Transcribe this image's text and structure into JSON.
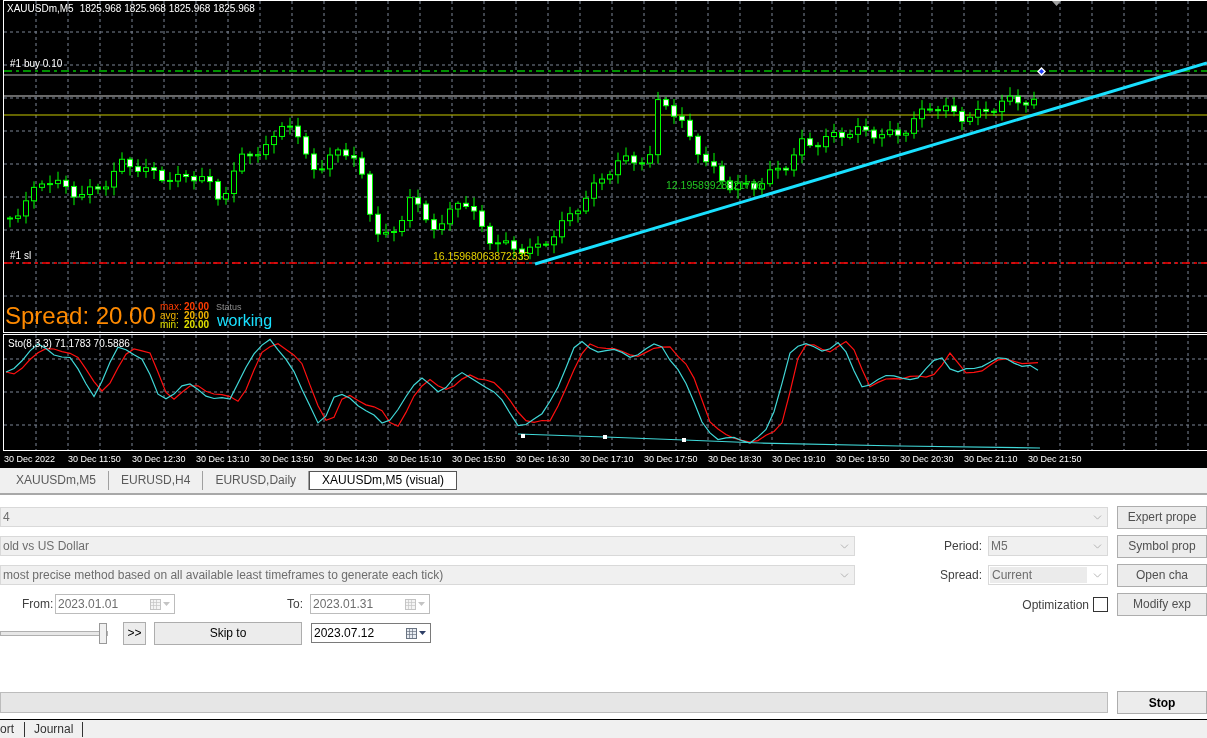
{
  "chart": {
    "symbol": "XAUUSDm,M5",
    "prices": "1825.968 1825.968 1825.968 1825.968",
    "order_lines": [
      {
        "kind": "buy",
        "label": "#1 buy 0.10"
      },
      {
        "kind": "stop_loss",
        "label": "#1 sl"
      }
    ],
    "price_labels": [
      {
        "text": "12.19589928821776",
        "color": "#22c322"
      },
      {
        "text": "16.15968063872335",
        "color": "#e6d200"
      }
    ],
    "spread": {
      "label": "Spread: 20.00",
      "stats": [
        {
          "name": "max:",
          "value": "20.00",
          "color": "#ff3c00"
        },
        {
          "name": "avg:",
          "value": "20.00",
          "color": "#f0b400"
        },
        {
          "name": "min:",
          "value": "20.00",
          "color": "#e0e000"
        }
      ]
    },
    "status": {
      "label": "Status",
      "value": "working"
    },
    "indicator": {
      "label": "Sto(8,3,3) 71.1783 70.5886"
    },
    "time_labels": [
      "30 Dec 2022",
      "30 Dec 11:50",
      "30 Dec 12:30",
      "30 Dec 13:10",
      "30 Dec 13:50",
      "30 Dec 14:30",
      "30 Dec 15:10",
      "30 Dec 15:50",
      "30 Dec 16:30",
      "30 Dec 17:10",
      "30 Dec 17:50",
      "30 Dec 18:30",
      "30 Dec 19:10",
      "30 Dec 19:50",
      "30 Dec 20:30",
      "30 Dec 21:10",
      "30 Dec 21:50"
    ]
  },
  "chart_tabs": [
    {
      "label": "XAUUSDm,M5",
      "selected": false
    },
    {
      "label": "EURUSD,H4",
      "selected": false
    },
    {
      "label": "EURUSD,Daily",
      "selected": false
    },
    {
      "label": "XAUUSDm,M5 (visual)",
      "selected": true
    }
  ],
  "tester": {
    "expert": {
      "value": "4",
      "disabled": true
    },
    "symbol": {
      "value": "old vs US Dollar",
      "disabled": true
    },
    "model": {
      "value": "most precise method based on all available least timeframes to generate each tick)",
      "disabled": true
    },
    "period": {
      "label": "Period:",
      "value": "M5",
      "disabled": true
    },
    "spread": {
      "label": "Spread:",
      "value": "Current",
      "disabled": true
    },
    "date_from": {
      "label": "From:",
      "value": "2023.01.01",
      "disabled": true
    },
    "date_to": {
      "label": "To:",
      "value": "2023.01.31",
      "disabled": true
    },
    "optimization": {
      "label": "Optimization",
      "checked": false
    },
    "speed_slider": {
      "level": 1
    },
    "fast_forward_button": {
      "label": ">>"
    },
    "skip_to_button": {
      "label": "Skip to"
    },
    "skip_date": {
      "value": "2023.07.12",
      "disabled": false
    },
    "progress": {
      "level": 0
    },
    "side_buttons": [
      {
        "label": "Expert prope",
        "disabled": true
      },
      {
        "label": "Symbol prop",
        "disabled": true
      },
      {
        "label": "Open cha",
        "disabled": true
      },
      {
        "label": "Modify exp",
        "disabled": true
      }
    ],
    "stop_button": {
      "label": "Stop"
    }
  },
  "bottom_tabs": [
    {
      "label": "ort",
      "selected": false
    },
    {
      "label": "Journal",
      "selected": false
    }
  ]
}
